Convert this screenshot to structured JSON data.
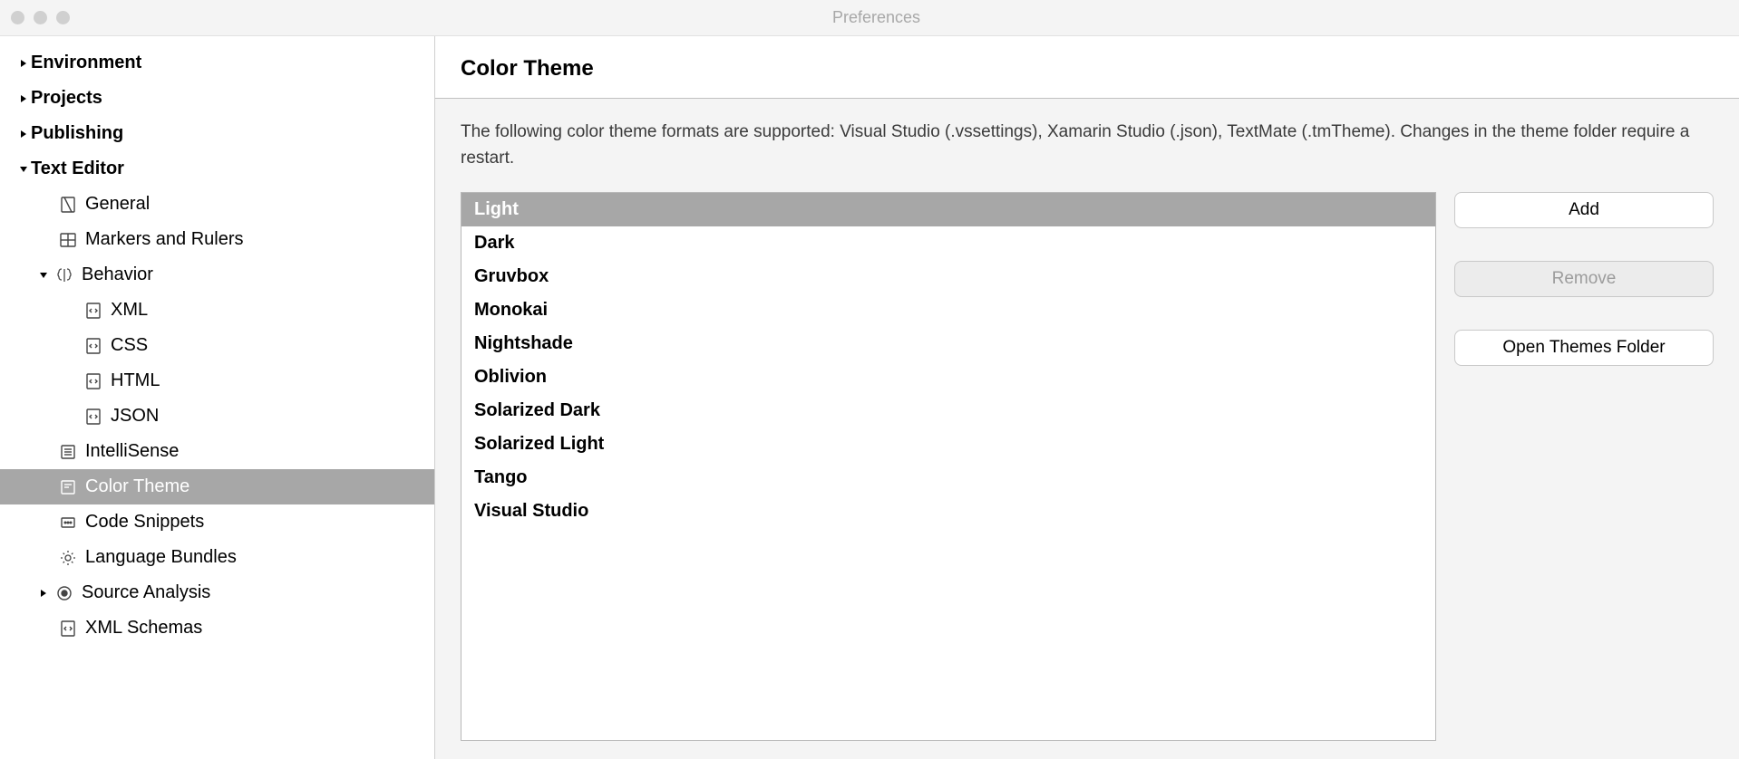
{
  "window": {
    "title": "Preferences"
  },
  "sidebar": {
    "items": [
      {
        "label": "Environment"
      },
      {
        "label": "Projects"
      },
      {
        "label": "Publishing"
      },
      {
        "label": "Text Editor"
      },
      {
        "label": "General"
      },
      {
        "label": "Markers and Rulers"
      },
      {
        "label": "Behavior"
      },
      {
        "label": "XML"
      },
      {
        "label": "CSS"
      },
      {
        "label": "HTML"
      },
      {
        "label": "JSON"
      },
      {
        "label": "IntelliSense"
      },
      {
        "label": "Color Theme"
      },
      {
        "label": "Code Snippets"
      },
      {
        "label": "Language Bundles"
      },
      {
        "label": "Source Analysis"
      },
      {
        "label": "XML Schemas"
      }
    ]
  },
  "panel": {
    "heading": "Color Theme",
    "description": "The following color theme formats are supported: Visual Studio (.vssettings), Xamarin Studio (.json), TextMate (.tmTheme). Changes in the theme folder require a restart.",
    "themes": [
      "Light",
      "Dark",
      "Gruvbox",
      "Monokai",
      "Nightshade",
      "Oblivion",
      "Solarized Dark",
      "Solarized Light",
      "Tango",
      "Visual Studio"
    ],
    "selected_theme_index": 0,
    "buttons": {
      "add": "Add",
      "remove": "Remove",
      "open_folder": "Open Themes Folder"
    }
  }
}
